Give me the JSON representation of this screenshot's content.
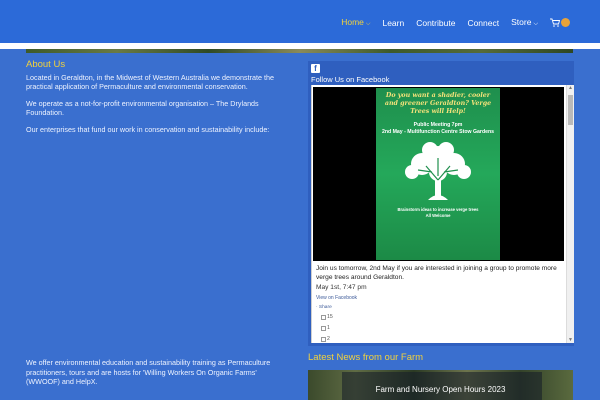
{
  "nav": {
    "items": [
      {
        "label": "Home",
        "active": true,
        "has_dropdown": true
      },
      {
        "label": "Learn",
        "active": false,
        "has_dropdown": false
      },
      {
        "label": "Contribute",
        "active": false,
        "has_dropdown": false
      },
      {
        "label": "Connect",
        "active": false,
        "has_dropdown": false
      },
      {
        "label": "Store",
        "active": false,
        "has_dropdown": true
      }
    ],
    "cart_icon": "cart-icon"
  },
  "about": {
    "heading": "About Us",
    "p1": "Located in Geraldton, in the Midwest of Western Australia we demonstrate the practical application of Permaculture and environmental conservation.",
    "p2": "We operate as a not-for-profit environmental organisation – The Drylands Foundation.",
    "p3": "Our enterprises that fund our work in conservation and sustainability include:",
    "p4": "We offer environmental education and sustainability training as Permaculture practitioners, tours and are hosts for 'Willing Workers On Organic Farms' (WWOOF) and HelpX."
  },
  "facebook": {
    "title": "Follow Us on Facebook",
    "poster": {
      "headline": "Do you want a shadier, cooler and greener Geraldton? Verge Trees will Help!",
      "meeting_line1": "Public Meeting 7pm",
      "meeting_line2": "2nd May - Multifunction Centre Stow Gardens",
      "foot_line1": "Brainstorm ideas to increase verge trees",
      "foot_line2": "All Welcome"
    },
    "post_text": "Join us tomorrow, 2nd May if you are interested in joining a group to promote more verge trees around Geraldton.",
    "post_time": "May 1st, 7:47 pm",
    "view_on_facebook": "View on Facebook",
    "share": "· Share",
    "likes": "15",
    "comments": "1",
    "shares": "2"
  },
  "news": {
    "heading": "Latest News from our Farm",
    "card_title": "Farm and Nursery Open Hours 2023"
  },
  "colors": {
    "background": "#3a6fcf",
    "accent": "#f2d23c",
    "header": "#2c6ad8"
  }
}
